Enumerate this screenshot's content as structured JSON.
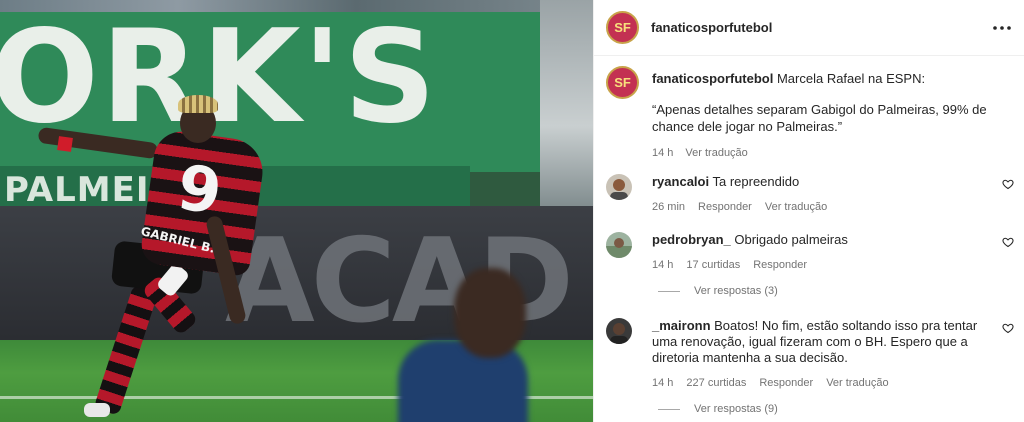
{
  "photo": {
    "banner_text": "ORK'S",
    "banner2_text": "PALMEIRAS",
    "board_text": "ACAD",
    "jersey_number": "9",
    "jersey_name": "GABRIEL B."
  },
  "header": {
    "avatar_text": "SF",
    "username": "fanaticosporfutebol",
    "more_icon": "more-horizontal-icon"
  },
  "caption": {
    "avatar_text": "SF",
    "username": "fanaticosporfutebol",
    "text": "Marcela Rafael na ESPN:",
    "quote": "“Apenas detalhes separam Gabigol do Palmeiras, 99% de chance dele jogar no Palmeiras.”",
    "time": "14 h",
    "translate": "Ver tradução"
  },
  "comments": [
    {
      "username": "ryancaloi",
      "text": "Ta repreendido",
      "time": "26 min",
      "likes": "",
      "reply": "Responder",
      "translate": "Ver tradução",
      "replies": ""
    },
    {
      "username": "pedrobryan_",
      "text": "Obrigado palmeiras",
      "time": "14 h",
      "likes": "17 curtidas",
      "reply": "Responder",
      "translate": "",
      "replies": "Ver respostas (3)"
    },
    {
      "username": "_maironn",
      "text": "Boatos! No fim, estão soltando isso pra tentar uma renovação, igual fizeram com o BH. Espero que a diretoria mantenha a sua decisão.",
      "time": "14 h",
      "likes": "227 curtidas",
      "reply": "Responder",
      "translate": "Ver tradução",
      "replies": "Ver respostas (9)"
    }
  ],
  "colors": {
    "brand_logo": "#c33152",
    "text": "#262626",
    "muted": "#737373"
  }
}
